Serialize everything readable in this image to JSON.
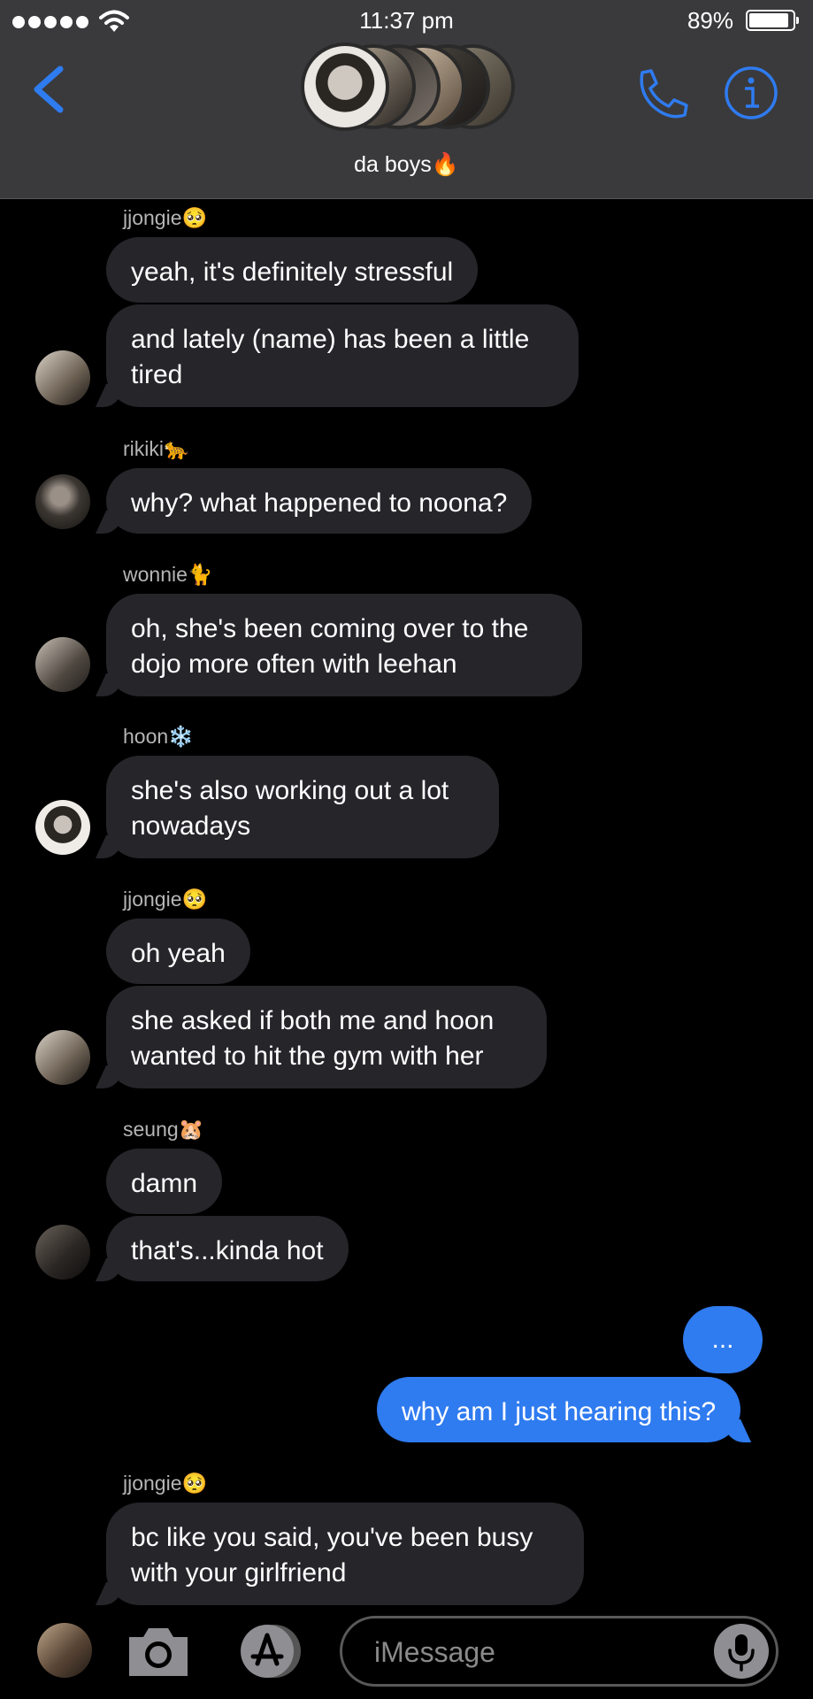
{
  "status_bar": {
    "time": "11:37 pm",
    "battery": "89%"
  },
  "header": {
    "group_name": "da boys🔥",
    "back_icon": "chevron-left-icon",
    "call_icon": "phone-icon",
    "info_icon": "info-icon",
    "accent_color": "#2f7bf0"
  },
  "messages": [
    {
      "sender": "jjongie🥺",
      "bubbles": [
        "yeah, it's definitely stressful",
        "and lately (name) has been a little tired"
      ]
    },
    {
      "sender": "rikiki🐆",
      "bubbles": [
        "why? what happened to noona?"
      ]
    },
    {
      "sender": "wonnie🐈",
      "bubbles": [
        "oh, she's been coming over to the dojo more often with leehan"
      ]
    },
    {
      "sender": "hoon❄️",
      "bubbles": [
        "she's also working out a lot nowadays"
      ]
    },
    {
      "sender": "jjongie🥺",
      "bubbles": [
        "oh yeah",
        "she asked if both me and hoon wanted to hit the gym with her"
      ]
    },
    {
      "sender": "seung🐹",
      "bubbles": [
        "damn",
        "that's...kinda hot"
      ]
    },
    {
      "sender": "me",
      "bubbles": [
        "...",
        "why am I just hearing this?"
      ]
    },
    {
      "sender": "jjongie🥺",
      "bubbles": [
        "bc like you said, you've been busy with your girlfriend"
      ]
    }
  ],
  "input": {
    "placeholder": "iMessage"
  }
}
